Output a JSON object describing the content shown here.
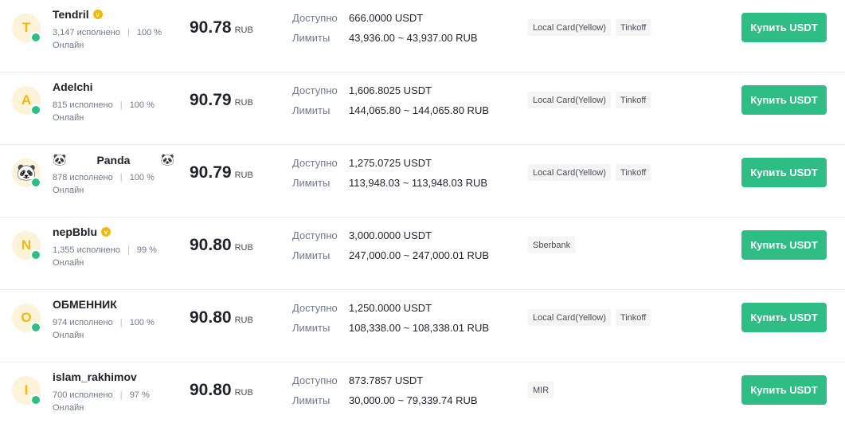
{
  "labels": {
    "available": "Доступно",
    "limits": "Лимиты",
    "completed": "исполнено",
    "sep": "|"
  },
  "offers": [
    {
      "initial": "T",
      "name": "Tendril",
      "verified": true,
      "orders": "3,147",
      "completion": "100 %",
      "status": "Онлайн",
      "price": "90.78",
      "currency": "RUB",
      "available": "666.0000 USDT",
      "limits": "43,936.00 ~ 43,937.00 RUB",
      "methods": [
        "Local Card(Yellow)",
        "Tinkoff"
      ],
      "button": "Купить USDT"
    },
    {
      "initial": "A",
      "name": "Adelchi",
      "verified": false,
      "orders": "815",
      "completion": "100 %",
      "status": "Онлайн",
      "price": "90.79",
      "currency": "RUB",
      "available": "1,606.8025 USDT",
      "limits": "144,065.80 ~ 144,065.80 RUB",
      "methods": [
        "Local Card(Yellow)",
        "Tinkoff"
      ],
      "button": "Купить USDT"
    },
    {
      "initial": "🐼",
      "name": "Panda",
      "panda": true,
      "verified": false,
      "orders": "878",
      "completion": "100 %",
      "status": "Онлайн",
      "price": "90.79",
      "currency": "RUB",
      "available": "1,275.0725 USDT",
      "limits": "113,948.03 ~ 113,948.03 RUB",
      "methods": [
        "Local Card(Yellow)",
        "Tinkoff"
      ],
      "button": "Купить USDT"
    },
    {
      "initial": "N",
      "name": "nepBblu",
      "verified": true,
      "orders": "1,355",
      "completion": "99 %",
      "status": "Онлайн",
      "price": "90.80",
      "currency": "RUB",
      "available": "3,000.0000 USDT",
      "limits": "247,000.00 ~ 247,000.01 RUB",
      "methods": [
        "Sberbank"
      ],
      "button": "Купить USDT"
    },
    {
      "initial": "O",
      "name": "ОБМЕННИК",
      "verified": false,
      "orders": "974",
      "completion": "100 %",
      "status": "Онлайн",
      "price": "90.80",
      "currency": "RUB",
      "available": "1,250.0000 USDT",
      "limits": "108,338.00 ~ 108,338.01 RUB",
      "methods": [
        "Local Card(Yellow)",
        "Tinkoff"
      ],
      "button": "Купить USDT"
    },
    {
      "initial": "I",
      "name": "islam_rakhimov",
      "verified": false,
      "orders": "700",
      "completion": "97 %",
      "status": "Онлайн",
      "price": "90.80",
      "currency": "RUB",
      "available": "873.7857 USDT",
      "limits": "30,000.00 ~ 79,339.74 RUB",
      "methods": [
        "MIR"
      ],
      "button": "Купить USDT"
    }
  ],
  "colors": {
    "accent": "#2ebd85",
    "badge": "#f0b90b",
    "avatar_bg": "#fdf3d9"
  }
}
